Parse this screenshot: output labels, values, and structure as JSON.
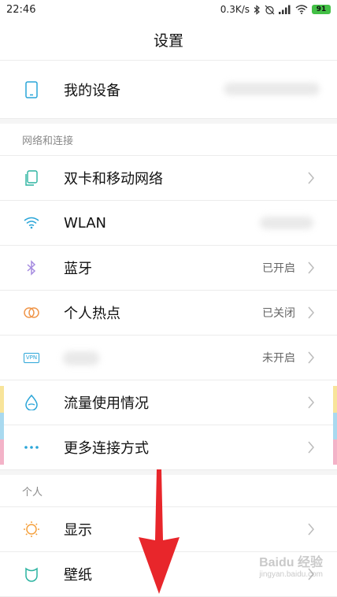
{
  "status_bar": {
    "time": "22:46",
    "speed": "0.3K/s",
    "battery": "91"
  },
  "header": {
    "title": "设置"
  },
  "device": {
    "label": "我的设备"
  },
  "sections": [
    {
      "header": "网络和连接",
      "items": [
        {
          "label": "双卡和移动网络",
          "value": "",
          "icon": "sim-cards-icon"
        },
        {
          "label": "WLAN",
          "value": "",
          "icon": "wifi-icon"
        },
        {
          "label": "蓝牙",
          "value": "已开启",
          "icon": "bluetooth-icon"
        },
        {
          "label": "个人热点",
          "value": "已关闭",
          "icon": "hotspot-icon"
        },
        {
          "label": "",
          "value": "未开启",
          "icon": "vpn-icon",
          "icon_text": "VPN"
        },
        {
          "label": "流量使用情况",
          "value": "",
          "icon": "data-usage-icon"
        },
        {
          "label": "更多连接方式",
          "value": "",
          "icon": "more-connections-icon"
        }
      ]
    },
    {
      "header": "个人",
      "items": [
        {
          "label": "显示",
          "value": "",
          "icon": "display-icon"
        },
        {
          "label": "壁纸",
          "value": "",
          "icon": "wallpaper-icon"
        }
      ]
    }
  ],
  "watermark": "Baidu 经验",
  "watermark_url": "jingyan.baidu.com",
  "colors": {
    "accent_teal": "#2bb3a0",
    "icon_blue": "#2aa5d8",
    "bluetooth_purple": "#a58be0",
    "hotspot_orange": "#f0964a",
    "display_orange": "#f5a03c",
    "arrow_red": "#e8262b",
    "battery_green": "#43c046"
  }
}
